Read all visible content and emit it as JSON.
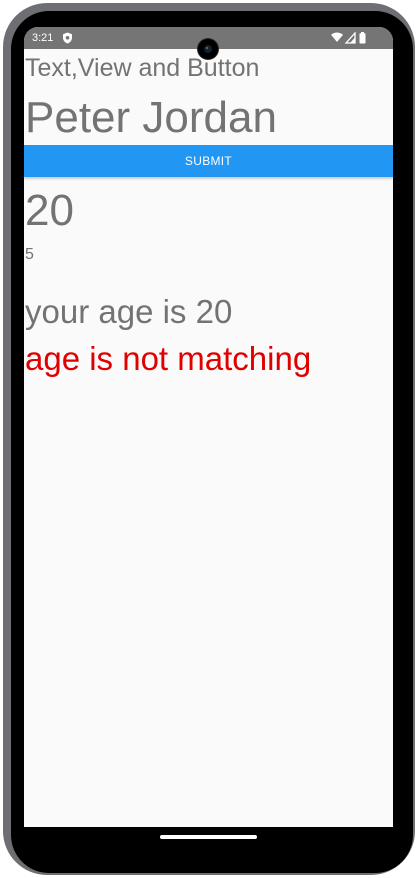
{
  "status_bar": {
    "time": "3:21",
    "icons": [
      "shield-icon",
      "wifi-icon",
      "signal-icon",
      "battery-icon"
    ]
  },
  "app": {
    "heading": "Text,View and Button",
    "name_value": "Peter Jordan",
    "submit_label": "SUBMIT",
    "age_value": "20",
    "small_value": "5",
    "age_result": "your age is 20",
    "match_status": "age is not matching"
  },
  "colors": {
    "button": "#2196f3",
    "text": "#737373",
    "error": "#e00000",
    "status_bar": "#757575"
  }
}
